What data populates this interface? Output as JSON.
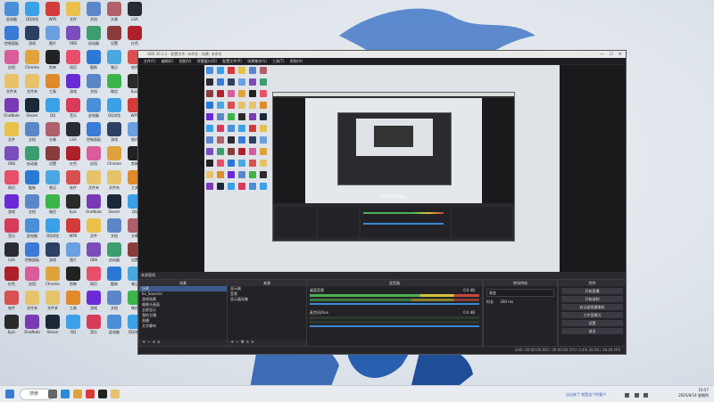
{
  "window": {
    "title": "OBS 30.2.2 - 配置文件: 未命名 - 场景: 未命名",
    "menu": [
      "文件(F)",
      "编辑(E)",
      "视图(V)",
      "停靠窗口(D)",
      "配置文件(P)",
      "场景集合(S)",
      "工具(T)",
      "帮助(H)"
    ],
    "win_buttons": [
      "—",
      "☐",
      "✕"
    ]
  },
  "docks": {
    "scenes_header": "来源管理",
    "scenes_title": "场景",
    "scenes": [
      "场景",
      "Ex_Sources",
      "游戏场景",
      "摄像头画面",
      "全屏显示",
      "我的主播",
      "直播",
      "文字幕布"
    ],
    "sources_title": "来源",
    "sources": [
      "显示器",
      "音频",
      "显示器采集"
    ],
    "mixer_title": "混音器",
    "mixer": [
      {
        "name": "桌面音频",
        "level": "0.0 dB"
      },
      {
        "name": "麦克风/Aux",
        "level": "0.0 dB"
      }
    ],
    "transition_title": "转场特效",
    "transition_label": "渐变",
    "transition_duration_label": "时长",
    "transition_duration": "300 ms",
    "controls_title": "控件",
    "controls": [
      "开始直播",
      "开始录制",
      "启动虚拟摄像机",
      "工作室模式",
      "设置",
      "退出"
    ],
    "add_label": "+",
    "tool_symbols": [
      "−",
      "⚙",
      "∧",
      "∨"
    ]
  },
  "status": {
    "text": "LIVE: 00:00:00   REC: 00:00:00   CPU: 0.4%   30.00 / 30.00 FPS"
  },
  "preview": {
    "caption": "中最平台开播标"
  },
  "desktop": {
    "icons": [
      {
        "label": "此电脑",
        "color": "#4a8fd8"
      },
      {
        "label": "QQ浏览",
        "color": "#3aa1e8"
      },
      {
        "label": "WPS",
        "color": "#d33a3a"
      },
      {
        "label": "文件",
        "color": "#e8c04a"
      },
      {
        "label": "文档",
        "color": "#5b87c9"
      },
      {
        "label": "头像",
        "color": "#b0606a"
      },
      {
        "label": "LSA",
        "color": "#2a2a35"
      },
      {
        "label": "控制面板",
        "color": "#3a7bd5"
      },
      {
        "label": "游戏",
        "color": "#2d3f63"
      },
      {
        "label": "图片",
        "color": "#6aa0e0"
      },
      {
        "label": "OBS",
        "color": "#7a4dbb"
      },
      {
        "label": "启动器",
        "color": "#3c9d6e"
      },
      {
        "label": "设置",
        "color": "#8a3c3c"
      },
      {
        "label": "红色",
        "color": "#b0202a"
      },
      {
        "label": "应用",
        "color": "#d85d9a"
      },
      {
        "label": "Chrome",
        "color": "#e0a23a"
      },
      {
        "label": "剪映",
        "color": "#222"
      },
      {
        "label": "网页",
        "color": "#e84f6a"
      },
      {
        "label": "酷狗",
        "color": "#2a7ad5"
      },
      {
        "label": "笔记",
        "color": "#4aa8e0"
      },
      {
        "label": "软件",
        "color": "#d85050"
      },
      {
        "label": "文件夹",
        "color": "#e6c36a"
      },
      {
        "label": "文件夹",
        "color": "#e6c36a"
      },
      {
        "label": "工具",
        "color": "#e08a2a"
      },
      {
        "label": "游戏",
        "color": "#6a2ad5"
      },
      {
        "label": "文档",
        "color": "#5b87c9"
      },
      {
        "label": "微信",
        "color": "#3ab54a"
      },
      {
        "label": "Epic",
        "color": "#2a2a2a"
      },
      {
        "label": "OneNote",
        "color": "#7a3ab5"
      },
      {
        "label": "Steam",
        "color": "#1b2838"
      },
      {
        "label": "QQ",
        "color": "#3aa1e8"
      },
      {
        "label": "音乐",
        "color": "#d83a5a"
      }
    ]
  },
  "taskbar": {
    "search_label": "搜索",
    "icons": [
      {
        "name": "start-icon",
        "color": "#3c7ad5"
      },
      {
        "name": "taskview-icon",
        "color": "#666"
      },
      {
        "name": "edge-icon",
        "color": "#2a8ad5"
      },
      {
        "name": "chrome-icon",
        "color": "#e0a23a"
      },
      {
        "name": "app-icon",
        "color": "#d83a3a"
      },
      {
        "name": "obs-icon",
        "color": "#222"
      },
      {
        "name": "file-icon",
        "color": "#e6c36a"
      }
    ],
    "tray_text": "出出来了 就是这个的客户",
    "time": "10:57",
    "date": "2025/8/14 星期四"
  },
  "colors": {
    "meter_green": "#4caf50",
    "meter_yellow": "#d6c33a",
    "meter_red": "#c8463a",
    "accent_blue": "#2b6fd0"
  }
}
